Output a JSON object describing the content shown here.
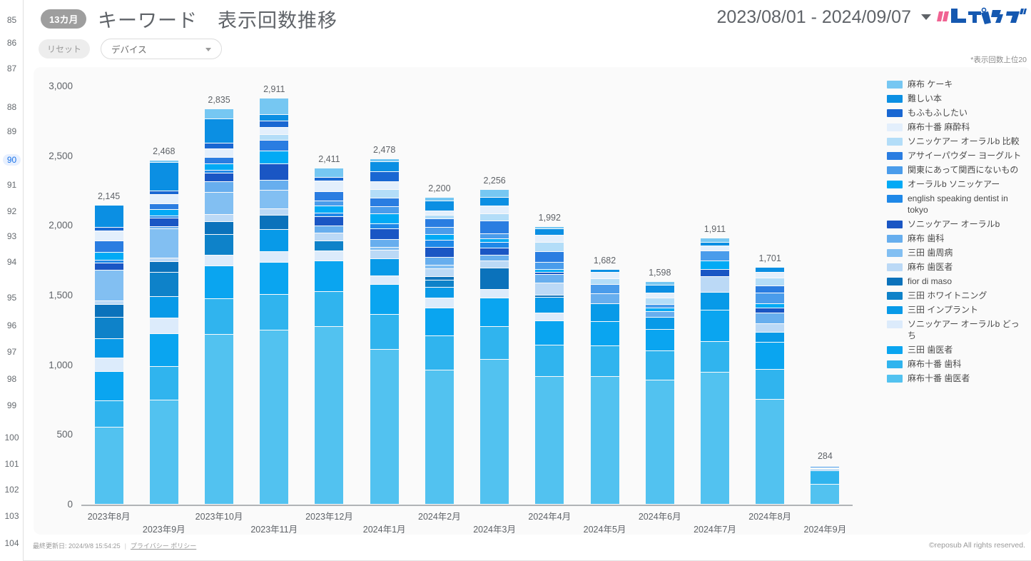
{
  "gutter": {
    "rows": [
      {
        "n": "85",
        "y": 20
      },
      {
        "n": "86",
        "y": 52
      },
      {
        "n": "87",
        "y": 88
      },
      {
        "n": "88",
        "y": 142
      },
      {
        "n": "89",
        "y": 176
      },
      {
        "n": "90",
        "y": 216,
        "active": true
      },
      {
        "n": "91",
        "y": 251
      },
      {
        "n": "92",
        "y": 288
      },
      {
        "n": "93",
        "y": 323
      },
      {
        "n": "94",
        "y": 359
      },
      {
        "n": "95",
        "y": 409
      },
      {
        "n": "96",
        "y": 448
      },
      {
        "n": "97",
        "y": 485
      },
      {
        "n": "98",
        "y": 523
      },
      {
        "n": "99",
        "y": 560
      },
      {
        "n": "100",
        "y": 605
      },
      {
        "n": "101",
        "y": 642
      },
      {
        "n": "102",
        "y": 678
      },
      {
        "n": "103",
        "y": 715
      },
      {
        "n": "104",
        "y": 753
      }
    ]
  },
  "header": {
    "period_badge": "13カ月",
    "title": "キーワード　表示回数推移",
    "date_range": "2023/08/01 - 2024/09/07",
    "logo_alt": "レポサブ"
  },
  "toolbar": {
    "reset_label": "リセット",
    "device_selected": "デバイス",
    "device_options": [
      "デバイス"
    ],
    "note": "*表示回数上位20"
  },
  "footer": {
    "last_updated": "最終更新日: 2024/9/8 15:54:25",
    "separator": "|",
    "privacy_link": "プライバシー ポリシー",
    "copyright": "©reposub All rights reserved."
  },
  "chart_data": {
    "type": "bar",
    "stacked": true,
    "title": "キーワード　表示回数推移",
    "xlabel": "",
    "ylabel": "",
    "ylim": [
      0,
      3000
    ],
    "yticks": [
      0,
      500,
      1000,
      1500,
      2000,
      2500,
      3000
    ],
    "ytick_labels": [
      "0",
      "500",
      "1,000",
      "1,500",
      "2,000",
      "2,500",
      "3,000"
    ],
    "grid": false,
    "legend_position": "right",
    "categories": [
      "2023年8月",
      "2023年9月",
      "2023年10月",
      "2023年11月",
      "2023年12月",
      "2024年1月",
      "2024年2月",
      "2024年3月",
      "2024年4月",
      "2024年5月",
      "2024年6月",
      "2024年7月",
      "2024年8月",
      "2024年9月"
    ],
    "totals": [
      2145,
      2468,
      2835,
      2911,
      2411,
      2478,
      2200,
      2256,
      1992,
      1682,
      1598,
      1911,
      1701,
      284
    ],
    "total_labels": [
      "2,145",
      "2,468",
      "2,835",
      "2,911",
      "2,411",
      "2,478",
      "2,200",
      "2,256",
      "1,992",
      "1,682",
      "1,598",
      "1,911",
      "1,701",
      "284"
    ],
    "series": [
      {
        "name": "麻布 ケーキ",
        "color": "#76c7f2",
        "values": [
          0,
          18,
          68,
          118,
          65,
          22,
          22,
          55,
          16,
          0,
          24,
          33,
          0,
          0
        ]
      },
      {
        "name": "難しい本",
        "color": "#0b8fe3",
        "values": [
          157,
          205,
          176,
          45,
          0,
          68,
          72,
          63,
          48,
          20,
          58,
          27,
          39,
          0
        ]
      },
      {
        "name": "もふもふしたい",
        "color": "#1967d2",
        "values": [
          25,
          21,
          40,
          46,
          28,
          74,
          0,
          0,
          0,
          0,
          0,
          0,
          0,
          0
        ]
      },
      {
        "name": "麻布十番 麻酔科",
        "color": "#e3effc",
        "values": [
          72,
          68,
          61,
          52,
          75,
          55,
          33,
          54,
          50,
          44,
          38,
          33,
          37,
          0
        ]
      },
      {
        "name": "ソニッケアー オーラルb 比較",
        "color": "#b3ddf8",
        "values": [
          0,
          0,
          0,
          38,
          0,
          62,
          27,
          51,
          65,
          43,
          47,
          0,
          56,
          9
        ]
      },
      {
        "name": "アサイーパウダー ヨーグルト",
        "color": "#2a7de1",
        "values": [
          86,
          41,
          48,
          76,
          68,
          60,
          60,
          92,
          77,
          0,
          0,
          0,
          52,
          6
        ]
      },
      {
        "name": "関東にあって関西にないもの",
        "color": "#4a9ceb",
        "values": [
          0,
          0,
          0,
          0,
          34,
          51,
          50,
          36,
          50,
          65,
          25,
          71,
          81,
          8
        ]
      },
      {
        "name": "オーラルb ソニッケアー",
        "color": "#02aaf5",
        "values": [
          54,
          47,
          45,
          96,
          50,
          76,
          41,
          26,
          20,
          0,
          25,
          65,
          27,
          0
        ]
      },
      {
        "name": "english speaking dentist in tokyo",
        "color": "#1f88e8",
        "values": [
          19,
          16,
          23,
          0,
          28,
          33,
          53,
          42,
          0,
          0,
          0,
          0,
          0,
          5
        ]
      },
      {
        "name": "ソニッケアー オーラルb",
        "color": "#1a56c4",
        "values": [
          53,
          63,
          62,
          117,
          66,
          77,
          70,
          49,
          20,
          0,
          0,
          49,
          35,
          0
        ]
      },
      {
        "name": "麻布 歯科",
        "color": "#67aeee",
        "values": [
          0,
          12,
          77,
          71,
          52,
          57,
          55,
          43,
          61,
          74,
          41,
          0,
          78,
          6
        ]
      },
      {
        "name": "三田 歯周病",
        "color": "#82bff2",
        "values": [
          218,
          209,
          155,
          132,
          0,
          22,
          30,
          0,
          0,
          0,
          0,
          0,
          0,
          7
        ]
      },
      {
        "name": "麻布 歯医者",
        "color": "#bbd9f6",
        "values": [
          30,
          30,
          52,
          48,
          58,
          61,
          52,
          51,
          85,
          0,
          0,
          113,
          64,
          0
        ]
      },
      {
        "name": "fior di maso",
        "color": "#0b72bb",
        "values": [
          89,
          74,
          95,
          102,
          0,
          0,
          28,
          151,
          15,
          0,
          0,
          0,
          0,
          0
        ]
      },
      {
        "name": "三田 ホワイトニング",
        "color": "#0e82c9",
        "values": [
          152,
          172,
          146,
          0,
          72,
          0,
          49,
          0,
          0,
          0,
          0,
          0,
          0,
          0
        ]
      },
      {
        "name": "三田 インプラント",
        "color": "#089ae8",
        "values": [
          140,
          154,
          0,
          160,
          0,
          120,
          80,
          0,
          112,
          126,
          84,
          128,
          70,
          0
        ]
      },
      {
        "name": "ソニッケアー オーラルb どっち",
        "color": "#dcebfb",
        "values": [
          96,
          116,
          76,
          74,
          68,
          65,
          68,
          62,
          55,
          0,
          0,
          0,
          0,
          0
        ]
      },
      {
        "name": "三田 歯医者",
        "color": "#0aa5f0",
        "values": [
          213,
          236,
          238,
          229,
          220,
          215,
          203,
          208,
          175,
          174,
          155,
          225,
          197,
          0
        ]
      },
      {
        "name": "麻布十番 歯科",
        "color": "#30b4ee",
        "values": [
          191,
          241,
          253,
          259,
          252,
          247,
          244,
          236,
          225,
          218,
          209,
          221,
          214,
          99
        ]
      },
      {
        "name": "麻布十番 歯医者",
        "color": "#52c2f0",
        "values": [
          550,
          745,
          1220,
          1248,
          1275,
          1113,
          963,
          1037,
          918,
          918,
          892,
          946,
          751,
          144
        ]
      }
    ]
  }
}
